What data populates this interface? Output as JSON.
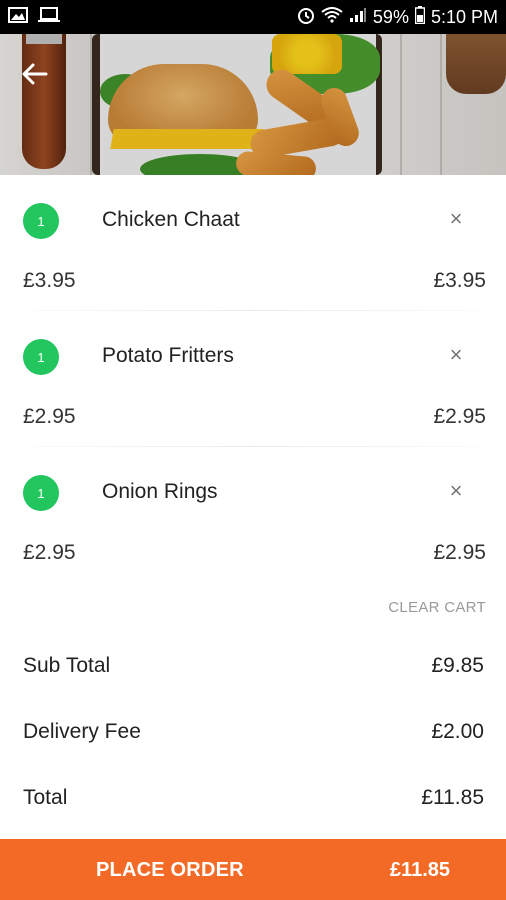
{
  "status_bar": {
    "battery_percent": "59%",
    "time": "5:10 PM",
    "icons": [
      "image-icon",
      "laptop-icon",
      "alarm-icon",
      "wifi-icon",
      "signal-icon",
      "battery-icon"
    ]
  },
  "header": {
    "back_icon": "arrow-left-icon"
  },
  "cart": {
    "items": [
      {
        "quantity": "1",
        "name": "Chicken Chaat",
        "unit_price": "£3.95",
        "line_total": "£3.95",
        "remove_icon": "×"
      },
      {
        "quantity": "1",
        "name": "Potato Fritters",
        "unit_price": "£2.95",
        "line_total": "£2.95",
        "remove_icon": "×"
      },
      {
        "quantity": "1",
        "name": "Onion Rings",
        "unit_price": "£2.95",
        "line_total": "£2.95",
        "remove_icon": "×"
      }
    ],
    "clear_cart_label": "CLEAR CART"
  },
  "summary": {
    "subtotal_label": "Sub Total",
    "subtotal_value": "£9.85",
    "delivery_label": "Delivery Fee",
    "delivery_value": "£2.00",
    "total_label": "Total",
    "total_value": "£11.85"
  },
  "place_order": {
    "label": "PLACE ORDER",
    "amount": "£11.85"
  },
  "colors": {
    "accent_orange": "#f26a25",
    "qty_green": "#22c55e"
  }
}
